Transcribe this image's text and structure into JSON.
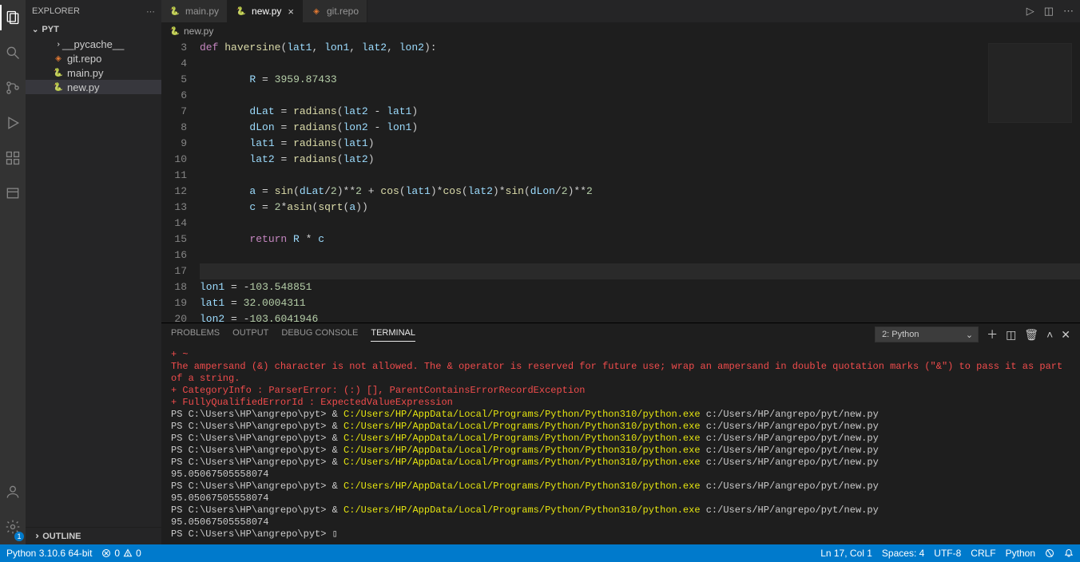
{
  "sidebar": {
    "title": "EXPLORER",
    "root": "PYT",
    "items": [
      {
        "label": "__pycache__",
        "kind": "folder-collapsed"
      },
      {
        "label": "git.repo",
        "kind": "git"
      },
      {
        "label": "main.py",
        "kind": "py"
      },
      {
        "label": "new.py",
        "kind": "py",
        "selected": true
      }
    ],
    "outline": "OUTLINE"
  },
  "tabs": [
    {
      "label": "main.py",
      "kind": "py",
      "active": false
    },
    {
      "label": "new.py",
      "kind": "py",
      "active": true
    },
    {
      "label": "git.repo",
      "kind": "git",
      "active": false
    }
  ],
  "breadcrumb": {
    "icon": "py",
    "label": "new.py"
  },
  "code_lines": [
    {
      "n": 3,
      "html": "<span class='tok-kw'>def</span> <span class='tok-fn'>haversine</span>(<span class='tok-var'>lat1</span>, <span class='tok-var'>lon1</span>, <span class='tok-var'>lat2</span>, <span class='tok-var'>lon2</span>):"
    },
    {
      "n": 4,
      "html": ""
    },
    {
      "n": 5,
      "html": "        <span class='tok-var'>R</span> <span class='tok-op'>=</span> <span class='tok-num'>3959.87433</span>"
    },
    {
      "n": 6,
      "html": ""
    },
    {
      "n": 7,
      "html": "        <span class='tok-var'>dLat</span> <span class='tok-op'>=</span> <span class='tok-fn'>radians</span>(<span class='tok-var'>lat2</span> <span class='tok-op'>-</span> <span class='tok-var'>lat1</span>)"
    },
    {
      "n": 8,
      "html": "        <span class='tok-var'>dLon</span> <span class='tok-op'>=</span> <span class='tok-fn'>radians</span>(<span class='tok-var'>lon2</span> <span class='tok-op'>-</span> <span class='tok-var'>lon1</span>)"
    },
    {
      "n": 9,
      "html": "        <span class='tok-var'>lat1</span> <span class='tok-op'>=</span> <span class='tok-fn'>radians</span>(<span class='tok-var'>lat1</span>)"
    },
    {
      "n": 10,
      "html": "        <span class='tok-var'>lat2</span> <span class='tok-op'>=</span> <span class='tok-fn'>radians</span>(<span class='tok-var'>lat2</span>)"
    },
    {
      "n": 11,
      "html": ""
    },
    {
      "n": 12,
      "html": "        <span class='tok-var'>a</span> <span class='tok-op'>=</span> <span class='tok-fn'>sin</span>(<span class='tok-var'>dLat</span><span class='tok-op'>/</span><span class='tok-num'>2</span>)<span class='tok-op'>**</span><span class='tok-num'>2</span> <span class='tok-op'>+</span> <span class='tok-fn'>cos</span>(<span class='tok-var'>lat1</span>)<span class='tok-op'>*</span><span class='tok-fn'>cos</span>(<span class='tok-var'>lat2</span>)<span class='tok-op'>*</span><span class='tok-fn'>sin</span>(<span class='tok-var'>dLon</span><span class='tok-op'>/</span><span class='tok-num'>2</span>)<span class='tok-op'>**</span><span class='tok-num'>2</span>"
    },
    {
      "n": 13,
      "html": "        <span class='tok-var'>c</span> <span class='tok-op'>=</span> <span class='tok-num'>2</span><span class='tok-op'>*</span><span class='tok-fn'>asin</span>(<span class='tok-fn'>sqrt</span>(<span class='tok-var'>a</span>))"
    },
    {
      "n": 14,
      "html": ""
    },
    {
      "n": 15,
      "html": "        <span class='tok-kw'>return</span> <span class='tok-var'>R</span> <span class='tok-op'>*</span> <span class='tok-var'>c</span>"
    },
    {
      "n": 16,
      "html": ""
    },
    {
      "n": 17,
      "html": "",
      "cursor": true
    },
    {
      "n": 18,
      "html": "<span class='tok-var'>lon1</span> <span class='tok-op'>=</span> <span class='tok-op'>-</span><span class='tok-num'>103.548851</span>"
    },
    {
      "n": 19,
      "html": "<span class='tok-var'>lat1</span> <span class='tok-op'>=</span> <span class='tok-num'>32.0004311</span>"
    },
    {
      "n": 20,
      "html": "<span class='tok-var'>lon2</span> <span class='tok-op'>=</span> <span class='tok-op'>-</span><span class='tok-num'>103.6041946</span>"
    }
  ],
  "panel": {
    "tabs": [
      "PROBLEMS",
      "OUTPUT",
      "DEBUG CONSOLE",
      "TERMINAL"
    ],
    "active_tab": "TERMINAL",
    "term_select": "2: Python"
  },
  "terminal_lines": [
    {
      "cls": "term-red",
      "text": "+ ~"
    },
    {
      "cls": "term-red",
      "text": "The ampersand (&) character is not allowed. The & operator is reserved for future use; wrap an ampersand in double quotation marks (\"&\") to pass it as part of a string."
    },
    {
      "cls": "term-red",
      "text": "    + CategoryInfo          : ParserError: (:) [], ParentContainsErrorRecordException"
    },
    {
      "cls": "term-red",
      "text": "    + FullyQualifiedErrorId : ExpectedValueExpression"
    },
    {
      "cls": "term-plain",
      "text": ""
    },
    {
      "cls": "mix",
      "segments": [
        {
          "cls": "term-plain",
          "t": "PS C:\\Users\\HP\\angrepo\\pyt> & "
        },
        {
          "cls": "term-yellow",
          "t": "C:/Users/HP/AppData/Local/Programs/Python/Python310/python.exe"
        },
        {
          "cls": "term-plain",
          "t": " c:/Users/HP/angrepo/pyt/new.py"
        }
      ]
    },
    {
      "cls": "mix",
      "segments": [
        {
          "cls": "term-plain",
          "t": "PS C:\\Users\\HP\\angrepo\\pyt> & "
        },
        {
          "cls": "term-yellow",
          "t": "C:/Users/HP/AppData/Local/Programs/Python/Python310/python.exe"
        },
        {
          "cls": "term-plain",
          "t": " c:/Users/HP/angrepo/pyt/new.py"
        }
      ]
    },
    {
      "cls": "mix",
      "segments": [
        {
          "cls": "term-plain",
          "t": "PS C:\\Users\\HP\\angrepo\\pyt> & "
        },
        {
          "cls": "term-yellow",
          "t": "C:/Users/HP/AppData/Local/Programs/Python/Python310/python.exe"
        },
        {
          "cls": "term-plain",
          "t": " c:/Users/HP/angrepo/pyt/new.py"
        }
      ]
    },
    {
      "cls": "mix",
      "segments": [
        {
          "cls": "term-plain",
          "t": "PS C:\\Users\\HP\\angrepo\\pyt> & "
        },
        {
          "cls": "term-yellow",
          "t": "C:/Users/HP/AppData/Local/Programs/Python/Python310/python.exe"
        },
        {
          "cls": "term-plain",
          "t": " c:/Users/HP/angrepo/pyt/new.py"
        }
      ]
    },
    {
      "cls": "mix",
      "segments": [
        {
          "cls": "term-plain",
          "t": "PS C:\\Users\\HP\\angrepo\\pyt> & "
        },
        {
          "cls": "term-yellow",
          "t": "C:/Users/HP/AppData/Local/Programs/Python/Python310/python.exe"
        },
        {
          "cls": "term-plain",
          "t": " c:/Users/HP/angrepo/pyt/new.py"
        }
      ]
    },
    {
      "cls": "term-plain",
      "text": "95.05067505558074"
    },
    {
      "cls": "mix",
      "segments": [
        {
          "cls": "term-plain",
          "t": "PS C:\\Users\\HP\\angrepo\\pyt> & "
        },
        {
          "cls": "term-yellow",
          "t": "C:/Users/HP/AppData/Local/Programs/Python/Python310/python.exe"
        },
        {
          "cls": "term-plain",
          "t": " c:/Users/HP/angrepo/pyt/new.py"
        }
      ]
    },
    {
      "cls": "term-plain",
      "text": "95.05067505558074"
    },
    {
      "cls": "mix",
      "segments": [
        {
          "cls": "term-plain",
          "t": "PS C:\\Users\\HP\\angrepo\\pyt> & "
        },
        {
          "cls": "term-yellow",
          "t": "C:/Users/HP/AppData/Local/Programs/Python/Python310/python.exe"
        },
        {
          "cls": "term-plain",
          "t": " c:/Users/HP/angrepo/pyt/new.py"
        }
      ]
    },
    {
      "cls": "term-plain",
      "text": "95.05067505558074"
    },
    {
      "cls": "term-plain",
      "text": "PS C:\\Users\\HP\\angrepo\\pyt> ▯"
    }
  ],
  "status": {
    "python": "Python 3.10.6 64-bit",
    "errors": "0",
    "warnings": "0",
    "ln_col": "Ln 17, Col 1",
    "spaces": "Spaces: 4",
    "encoding": "UTF-8",
    "eol": "CRLF",
    "lang": "Python"
  },
  "gear_badge": "1"
}
